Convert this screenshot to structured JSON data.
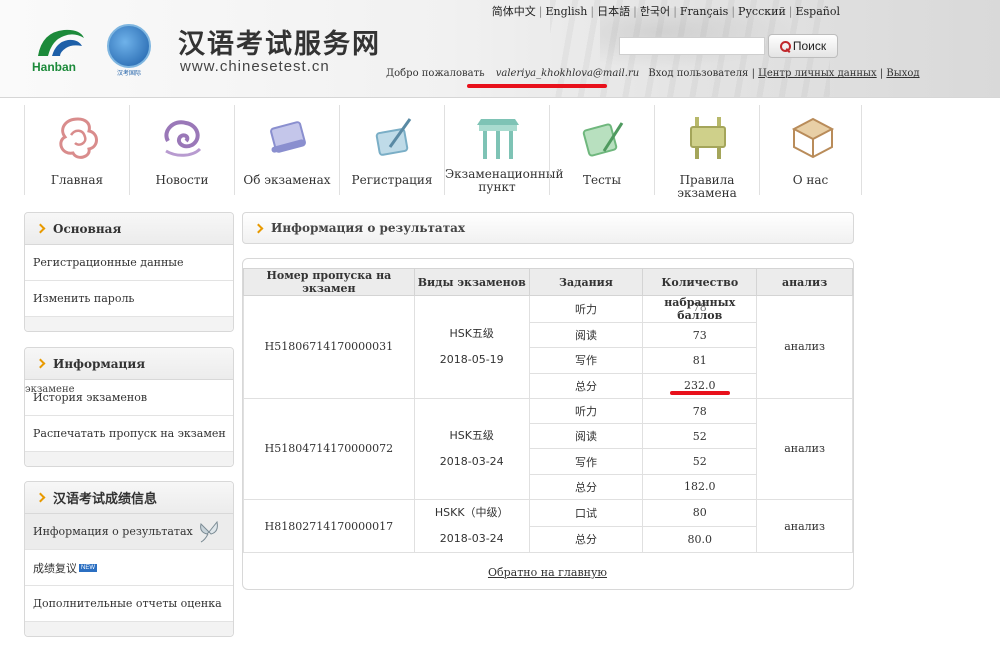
{
  "header": {
    "logo_text": "Hanban",
    "globe_caption": "汉考国际",
    "site_title": "汉语考试服务网",
    "site_url": "www.chinesetest.cn",
    "languages": [
      "简体中文",
      "English",
      "日本語",
      "한국어",
      "Français",
      "Русский",
      "Español"
    ],
    "search": {
      "button_label": "Поиск",
      "value": "",
      "icon": "search-icon"
    },
    "user": {
      "welcome": "Добро пожаловать",
      "email": "valeriya_khokhlova@mail.ru",
      "login_label": "Вход пользователя",
      "profile_link": "Центр личных данных",
      "logout_link": "Выход"
    }
  },
  "nav": [
    {
      "label": "Главная",
      "icon": "home-knot-icon"
    },
    {
      "label": "Новости",
      "icon": "news-cloud-icon"
    },
    {
      "label": "Об экзаменах",
      "icon": "scroll-icon"
    },
    {
      "label": "Регистрация",
      "icon": "brush-pen-icon"
    },
    {
      "label": "Экзаменационный пункт",
      "icon": "pavilion-icon"
    },
    {
      "label": "Тесты",
      "icon": "scroll-brush-icon"
    },
    {
      "label": "Правила экзамена",
      "icon": "bronze-vessel-icon"
    },
    {
      "label": "О нас",
      "icon": "table-icon"
    }
  ],
  "sidebar": {
    "basic": {
      "title": "Основная",
      "items": [
        "Регистрационные данные",
        "Изменить пароль"
      ]
    },
    "info": {
      "title": "Информация",
      "items": [
        {
          "label": "История экзаменов",
          "overlap": "экзамене"
        },
        {
          "label": "Распечатать пропуск на экзамен"
        }
      ]
    },
    "scores": {
      "title": "汉语考试成绩信息",
      "items": [
        {
          "label": "Информация о результатах"
        },
        {
          "label": "成绩复议",
          "badge": "NEW"
        },
        {
          "label": "Дополнительные отчеты оценка"
        }
      ]
    }
  },
  "main": {
    "section_title": "Информация о результатах",
    "table": {
      "headers": [
        "Номер пропуска на экзамен",
        "Виды экзаменов",
        "Задания",
        "Количество",
        "анализ"
      ],
      "score_note": "набранных баллов",
      "rows": [
        {
          "ticket": "H51806714170000031",
          "exam": "HSK五级",
          "date": "2018-05-19",
          "tasks": [
            {
              "name": "听力",
              "score": "78"
            },
            {
              "name": "阅读",
              "score": "73"
            },
            {
              "name": "写作",
              "score": "81"
            },
            {
              "name": "总分",
              "score": "232.0"
            }
          ],
          "analysis": "анализ"
        },
        {
          "ticket": "H51804714170000072",
          "exam": "HSK五级",
          "date": "2018-03-24",
          "tasks": [
            {
              "name": "听力",
              "score": "78"
            },
            {
              "name": "阅读",
              "score": "52"
            },
            {
              "name": "写作",
              "score": "52"
            },
            {
              "name": "总分",
              "score": "182.0"
            }
          ],
          "analysis": "анализ"
        },
        {
          "ticket": "H81802714170000017",
          "exam": "HSKK（中级）",
          "date": "2018-03-24",
          "tasks": [
            {
              "name": "口试",
              "score": "80"
            },
            {
              "name": "总分",
              "score": "80.0"
            }
          ],
          "analysis": "анализ"
        }
      ]
    },
    "back_link": "Обратно на главную"
  },
  "colors": {
    "accent": "#e89a00",
    "annotation_red": "#e8101b",
    "link": "#333333",
    "brand_green": "#1c8a3a"
  }
}
